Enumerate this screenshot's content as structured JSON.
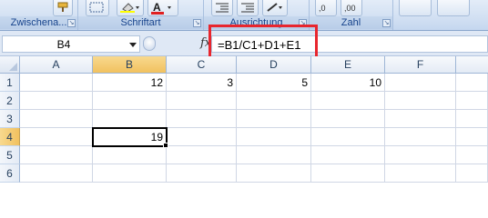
{
  "ribbon": {
    "groups": [
      {
        "label": "Zwischena..."
      },
      {
        "label": "Schriftart"
      },
      {
        "label": "Ausrichtung"
      },
      {
        "label": "Zahl"
      }
    ]
  },
  "formula_bar": {
    "name_box": "B4",
    "fx_label": "fx",
    "formula": "=B1/C1+D1+E1"
  },
  "sheet": {
    "columns": [
      "A",
      "B",
      "C",
      "D",
      "E",
      "F"
    ],
    "rows": [
      "1",
      "2",
      "3",
      "4",
      "5",
      "6"
    ],
    "cells": {
      "B1": "12",
      "C1": "3",
      "D1": "5",
      "E1": "10",
      "B4": "19"
    },
    "selected_cell": "B4"
  },
  "colors": {
    "highlight_border": "#e8262e",
    "ribbon_group_label": "#15428b",
    "header_active": "#f1c15f"
  }
}
